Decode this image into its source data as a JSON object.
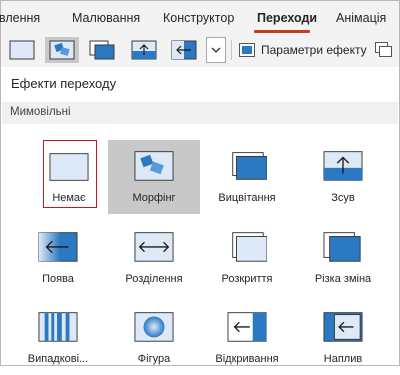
{
  "ribbon": {
    "tabs": [
      "влення",
      "Малювання",
      "Конструктор",
      "Переходи",
      "Анімація"
    ],
    "active_tab": "Переходи",
    "effect_options_label": "Параметри ефекту"
  },
  "panel": {
    "title": "Ефекти переходу",
    "section": "Мимовільні",
    "effects": [
      {
        "label": "Немає",
        "icon": "none-icon"
      },
      {
        "label": "Морфінг",
        "icon": "morph-icon"
      },
      {
        "label": "Вицвітання",
        "icon": "fade-icon"
      },
      {
        "label": "Зсув",
        "icon": "push-icon"
      },
      {
        "label": "Поява",
        "icon": "wipe-icon"
      },
      {
        "label": "Розділення",
        "icon": "split-icon"
      },
      {
        "label": "Розкриття",
        "icon": "reveal-icon"
      },
      {
        "label": "Різка зміна",
        "icon": "cut-icon"
      },
      {
        "label": "Випадкові...",
        "icon": "random-bars-icon"
      },
      {
        "label": "Фігура",
        "icon": "shape-icon"
      },
      {
        "label": "Відкривання",
        "icon": "uncover-icon"
      },
      {
        "label": "Наплив",
        "icon": "cover-icon"
      }
    ]
  },
  "colors": {
    "accent_underline": "#c43e1c",
    "focus_border": "#c4161c",
    "icon_blue": "#2b79c2"
  }
}
